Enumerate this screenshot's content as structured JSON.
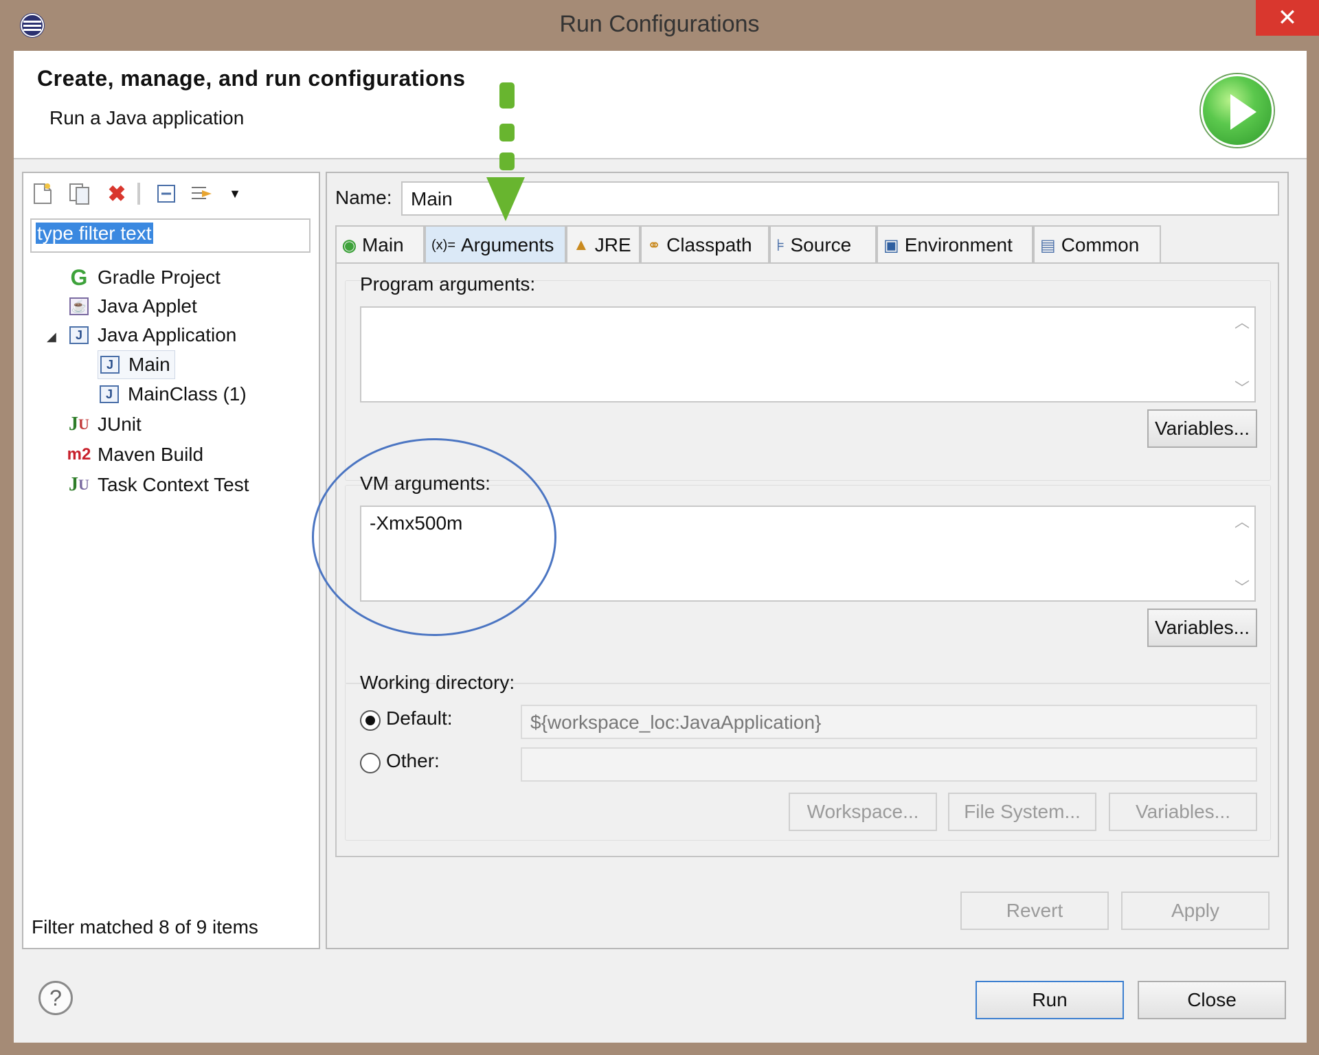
{
  "window": {
    "title": "Run Configurations",
    "close_glyph": "✕"
  },
  "header": {
    "title": "Create, manage, and run configurations",
    "subtitle": "Run a Java application"
  },
  "sidebar": {
    "filter_value": "type filter text",
    "items": [
      {
        "label": "Gradle Project",
        "icon": "gradle-icon"
      },
      {
        "label": "Java Applet",
        "icon": "java-applet-icon"
      },
      {
        "label": "Java Application",
        "icon": "java-application-icon"
      },
      {
        "label": "Main",
        "icon": "java-launch-icon"
      },
      {
        "label": "MainClass (1)",
        "icon": "java-launch-icon"
      },
      {
        "label": "JUnit",
        "icon": "junit-icon"
      },
      {
        "label": "Maven Build",
        "icon": "maven-icon"
      },
      {
        "label": "Task Context Test",
        "icon": "task-context-icon"
      }
    ],
    "status": "Filter matched 8 of 9 items"
  },
  "config": {
    "name_label": "Name:",
    "name_value": "Main",
    "tabs": [
      {
        "label": "Main",
        "icon": "main-tab-icon"
      },
      {
        "label": "Arguments",
        "icon": "arguments-tab-icon"
      },
      {
        "label": "JRE",
        "icon": "jre-tab-icon"
      },
      {
        "label": "Classpath",
        "icon": "classpath-tab-icon"
      },
      {
        "label": "Source",
        "icon": "source-tab-icon"
      },
      {
        "label": "Environment",
        "icon": "environment-tab-icon"
      },
      {
        "label": "Common",
        "icon": "common-tab-icon"
      }
    ],
    "active_tab": "Arguments",
    "program_args_label": "Program arguments:",
    "program_args_value": "",
    "variables_label": "Variables...",
    "vm_args_label": "VM arguments:",
    "vm_args_value": "-Xmx500m",
    "working_dir_label": "Working directory:",
    "default_label": "Default:",
    "default_value": "${workspace_loc:JavaApplication}",
    "other_label": "Other:",
    "other_value": "",
    "workspace_label": "Workspace...",
    "filesystem_label": "File System...",
    "revert_label": "Revert",
    "apply_label": "Apply"
  },
  "footer": {
    "run_label": "Run",
    "close_label": "Close",
    "help_glyph": "?"
  },
  "colors": {
    "accent": "#3a88e0",
    "annotation_circle": "#4b75c2",
    "annotation_arrow": "#68b52f",
    "delete_red": "#d9372e"
  }
}
